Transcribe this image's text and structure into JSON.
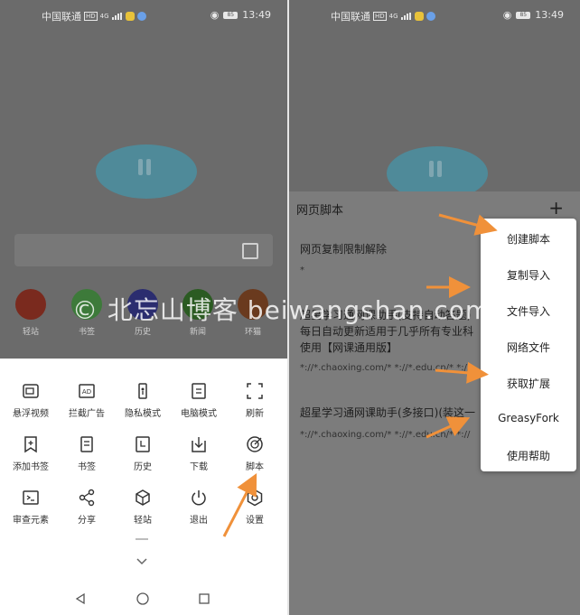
{
  "status": {
    "carrier": "中国联通",
    "hd": "HD",
    "network": "4G",
    "battery": "85",
    "time": "13:49"
  },
  "home": {
    "quicklinks": [
      {
        "label": "轻站",
        "color": "#7a2a1e"
      },
      {
        "label": "书签",
        "color": "#3d7a3a"
      },
      {
        "label": "历史",
        "color": "#2b2d6f"
      },
      {
        "label": "新闻",
        "color": "#2b5b22"
      },
      {
        "label": "环猫",
        "color": "#6a3a1e"
      }
    ]
  },
  "menu": {
    "items": [
      {
        "label": "悬浮视频",
        "icon": "floating-video-icon"
      },
      {
        "label": "拦截广告",
        "icon": "ad-block-icon"
      },
      {
        "label": "隐私模式",
        "icon": "privacy-mode-icon"
      },
      {
        "label": "电脑模式",
        "icon": "desktop-mode-icon"
      },
      {
        "label": "刷新",
        "icon": "refresh-icon"
      },
      {
        "label": "添加书签",
        "icon": "add-bookmark-icon"
      },
      {
        "label": "书签",
        "icon": "bookmarks-icon"
      },
      {
        "label": "历史",
        "icon": "history-icon"
      },
      {
        "label": "下载",
        "icon": "download-icon"
      },
      {
        "label": "脚本",
        "icon": "script-icon"
      },
      {
        "label": "审查元素",
        "icon": "inspect-element-icon"
      },
      {
        "label": "分享",
        "icon": "share-icon"
      },
      {
        "label": "轻站",
        "icon": "light-app-icon"
      },
      {
        "label": "退出",
        "icon": "exit-icon"
      },
      {
        "label": "设置",
        "icon": "settings-icon"
      }
    ]
  },
  "scripts": {
    "title": "网页脚本",
    "plus": "+",
    "item1_name": "网页复制限制解除",
    "item1_match": "*",
    "item2_line1": "超星学习通网课助手(支持自动答题)",
    "item2_line2": "每日自动更新适用于几乎所有专业科",
    "item2_line3": "使用【网课通用版】",
    "item2_match": "*://*.chaoxing.com/* *://*.edu.cn/* *://",
    "item3_name": "超星学习通网课助手(多接口)(装这一",
    "item3_match": "*://*.chaoxing.com/* *://*.edu.cn/* *://"
  },
  "dropdown": [
    "创建脚本",
    "复制导入",
    "文件导入",
    "网络文件",
    "获取扩展",
    "GreasyFork",
    "使用帮助"
  ],
  "watermark": "© 北忘山博客 beiwangshan.com",
  "colors": {
    "arrow": "#f0913a",
    "accent": "#4f8a99"
  }
}
